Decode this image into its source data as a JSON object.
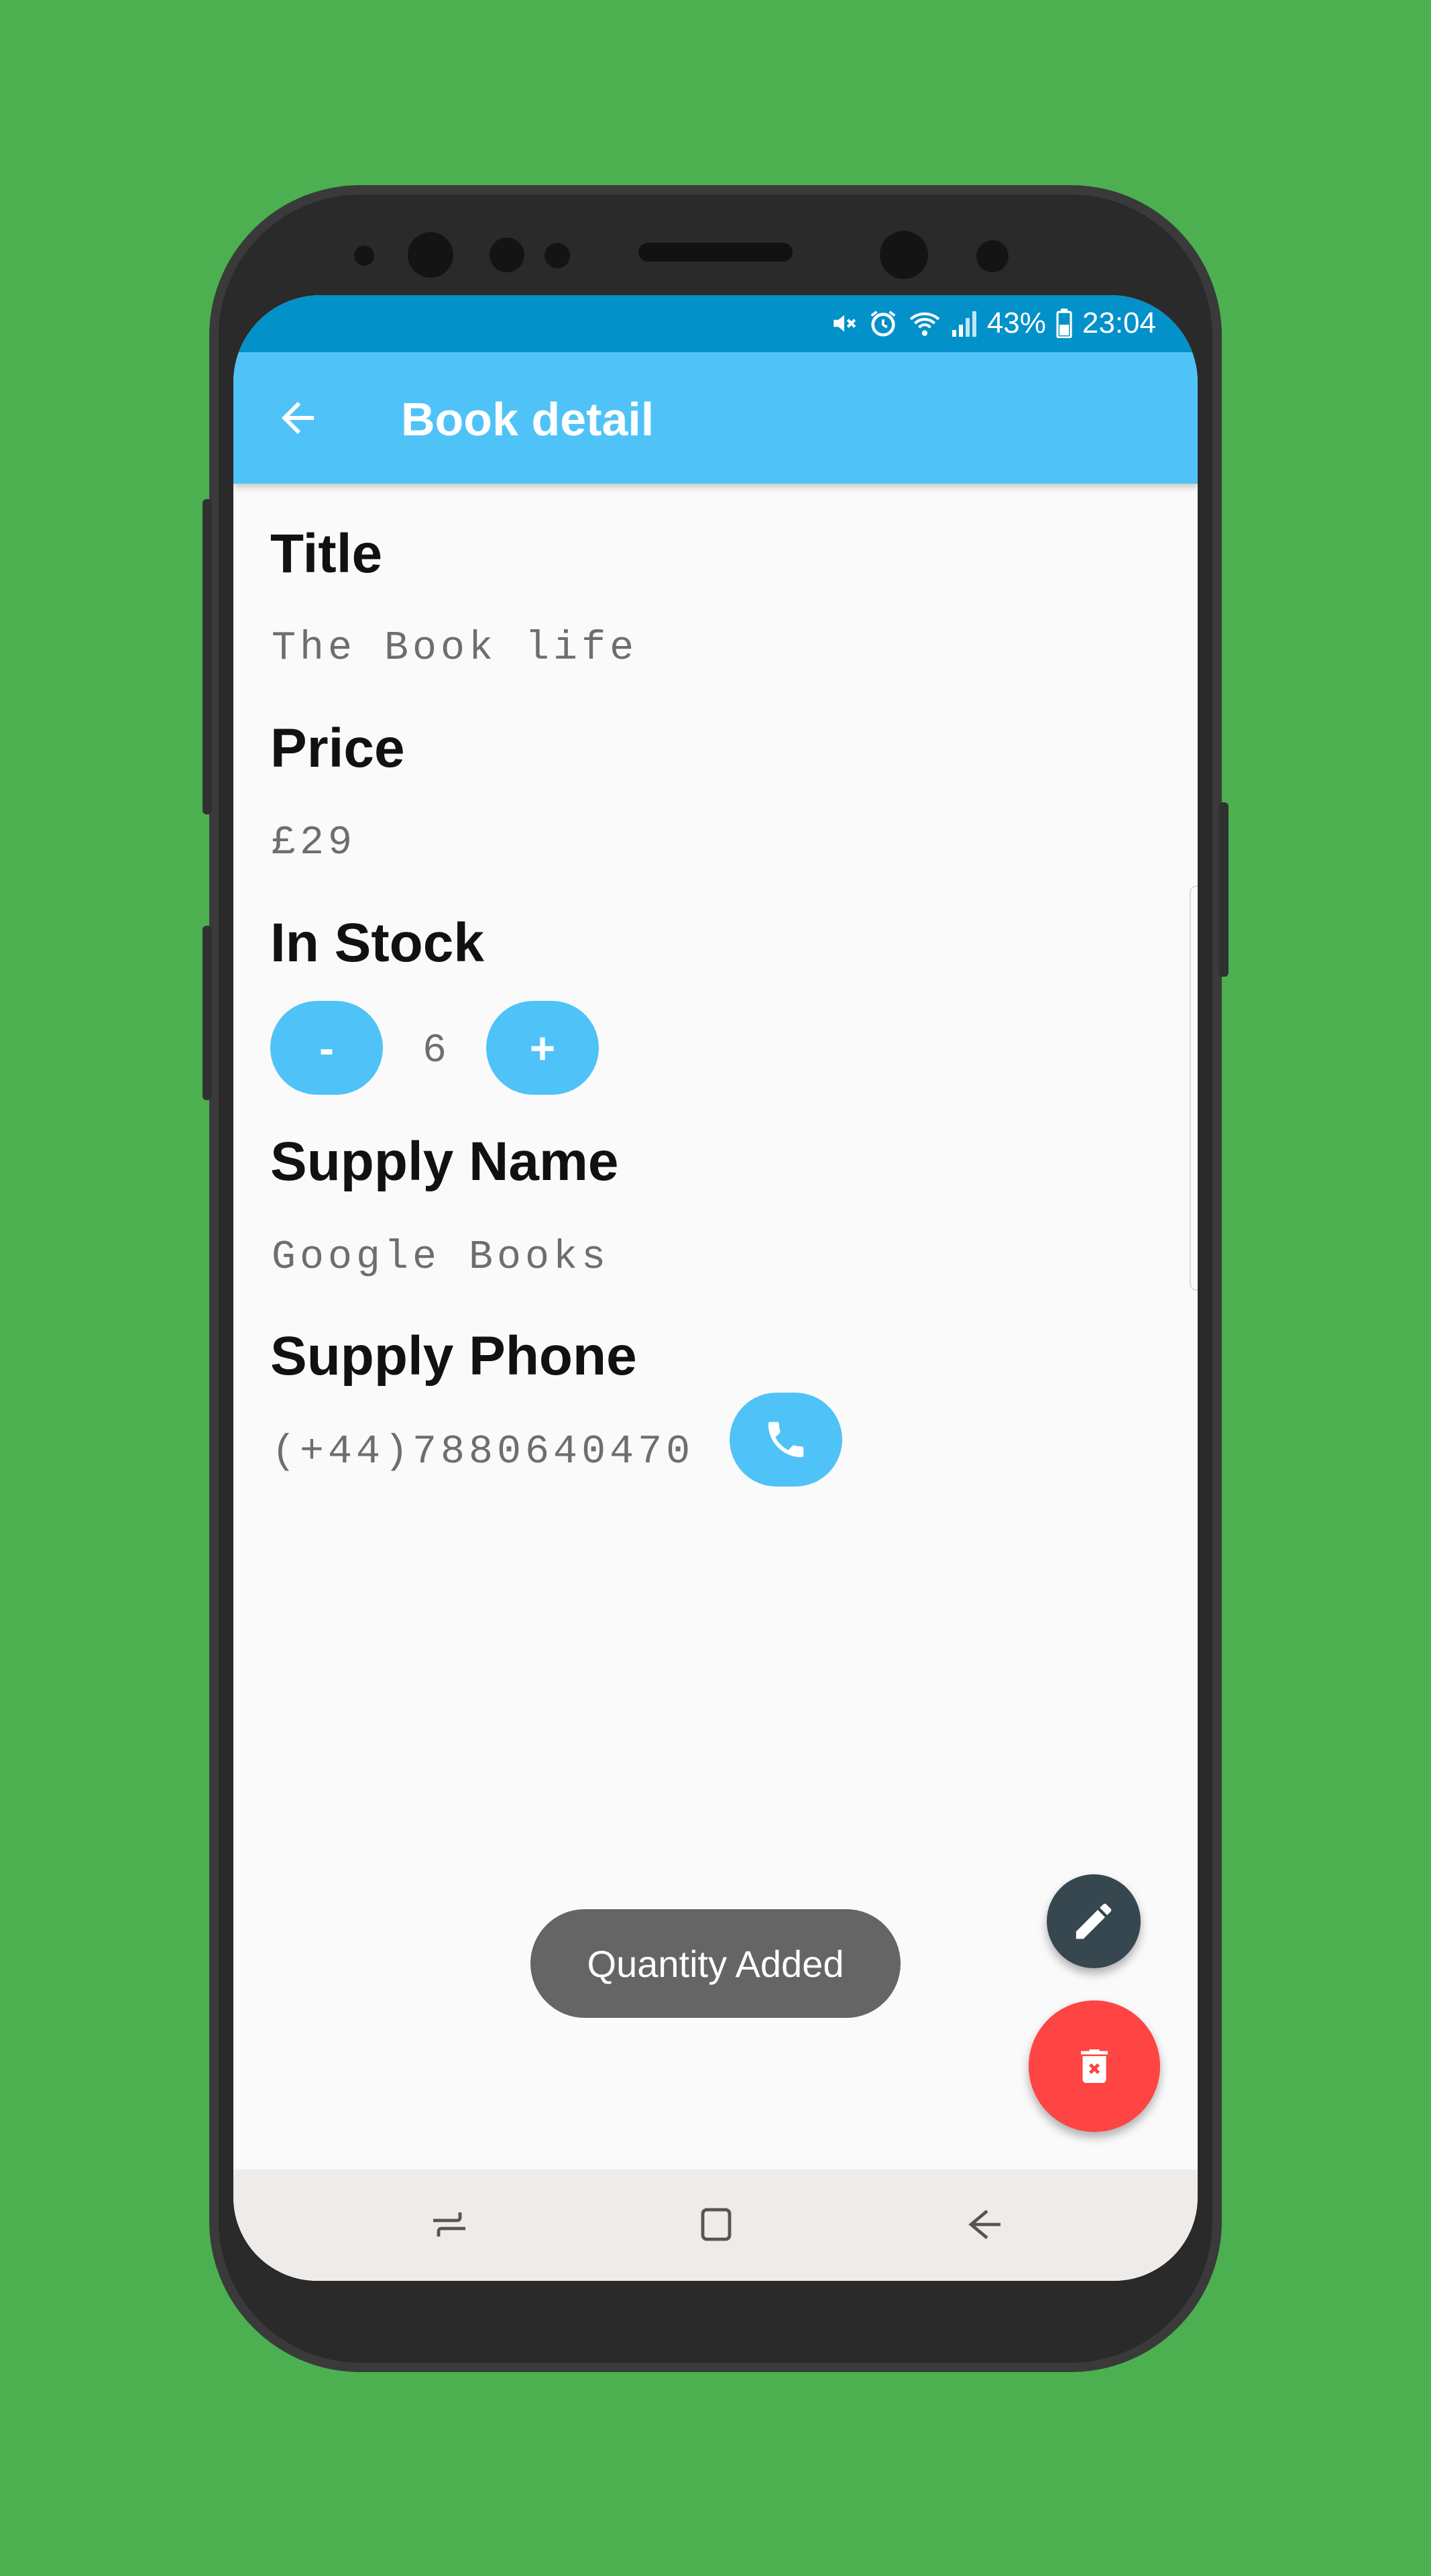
{
  "status_bar": {
    "battery": "43%",
    "time": "23:04",
    "icons": [
      "mute-icon",
      "alarm-icon",
      "wifi-icon",
      "signal-icon",
      "battery-icon"
    ]
  },
  "app_bar": {
    "title": "Book detail",
    "back_icon": "arrow-back-icon"
  },
  "book": {
    "title_label": "Title",
    "title_value": "The Book life",
    "price_label": "Price",
    "price_value": "£29",
    "stock_label": "In Stock",
    "decrement_label": "-",
    "quantity": "6",
    "increment_label": "+",
    "supplier_name_label": "Supply Name",
    "supplier_name_value": "Google Books",
    "supplier_phone_label": "Supply Phone",
    "supplier_phone_value": "(+44)7880640470",
    "call_icon": "phone-icon"
  },
  "toast": {
    "message": "Quantity Added"
  },
  "fabs": {
    "edit_icon": "pencil-icon",
    "delete_icon": "trash-icon"
  },
  "nav_bar": {
    "items": [
      "recent-apps-icon",
      "home-icon",
      "back-icon"
    ]
  },
  "colors": {
    "background": "#4caf50",
    "status_bar": "#0391c9",
    "app_bar": "#4fc3f7",
    "accent": "#4fc3f7",
    "edit_fab": "#37474f",
    "delete_fab": "#ff4444",
    "toast": "#656565"
  }
}
